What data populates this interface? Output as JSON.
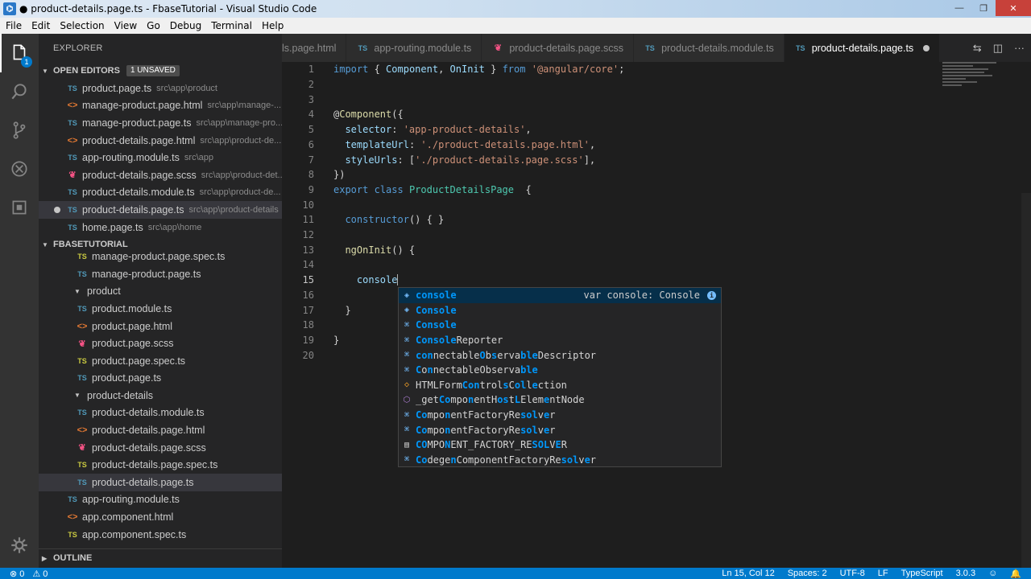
{
  "window": {
    "title": "● product-details.page.ts - FbaseTutorial - Visual Studio Code"
  },
  "menu": [
    "File",
    "Edit",
    "Selection",
    "View",
    "Go",
    "Debug",
    "Terminal",
    "Help"
  ],
  "activity": {
    "explorer_badge": "1"
  },
  "sidebar": {
    "title": "EXPLORER",
    "open_editors": {
      "label": "OPEN EDITORS",
      "badge": "1 UNSAVED",
      "items": [
        {
          "name": "product.page.ts",
          "path": "src\\app\\product",
          "type": "ts"
        },
        {
          "name": "manage-product.page.html",
          "path": "src\\app\\manage-...",
          "type": "html"
        },
        {
          "name": "manage-product.page.ts",
          "path": "src\\app\\manage-pro...",
          "type": "ts"
        },
        {
          "name": "product-details.page.html",
          "path": "src\\app\\product-de...",
          "type": "html"
        },
        {
          "name": "app-routing.module.ts",
          "path": "src\\app",
          "type": "ts"
        },
        {
          "name": "product-details.page.scss",
          "path": "src\\app\\product-det...",
          "type": "scss"
        },
        {
          "name": "product-details.module.ts",
          "path": "src\\app\\product-de...",
          "type": "ts"
        },
        {
          "name": "product-details.page.ts",
          "path": "src\\app\\product-details",
          "type": "ts"
        },
        {
          "name": "home.page.ts",
          "path": "src\\app\\home",
          "type": "ts"
        }
      ]
    },
    "project": {
      "label": "FBASETUTORIAL",
      "items": [
        {
          "name": "manage-product.page.spec.ts",
          "type": "ts-y",
          "depth": 1
        },
        {
          "name": "manage-product.page.ts",
          "type": "ts",
          "depth": 1
        },
        {
          "name": "product",
          "type": "folder",
          "depth": 0
        },
        {
          "name": "product.module.ts",
          "type": "ts",
          "depth": 1
        },
        {
          "name": "product.page.html",
          "type": "html",
          "depth": 1
        },
        {
          "name": "product.page.scss",
          "type": "scss",
          "depth": 1
        },
        {
          "name": "product.page.spec.ts",
          "type": "ts-y",
          "depth": 1
        },
        {
          "name": "product.page.ts",
          "type": "ts",
          "depth": 1
        },
        {
          "name": "product-details",
          "type": "folder",
          "depth": 0
        },
        {
          "name": "product-details.module.ts",
          "type": "ts",
          "depth": 1
        },
        {
          "name": "product-details.page.html",
          "type": "html",
          "depth": 1
        },
        {
          "name": "product-details.page.scss",
          "type": "scss",
          "depth": 1
        },
        {
          "name": "product-details.page.spec.ts",
          "type": "ts-y",
          "depth": 1
        },
        {
          "name": "product-details.page.ts",
          "type": "ts",
          "depth": 1
        },
        {
          "name": "app-routing.module.ts",
          "type": "ts",
          "depth": 0
        },
        {
          "name": "app.component.html",
          "type": "html",
          "depth": 0
        },
        {
          "name": "app.component.spec.ts",
          "type": "ts-y",
          "depth": 0
        }
      ]
    },
    "outline_label": "OUTLINE"
  },
  "tabs": [
    {
      "label": "ls.page.html",
      "type": "none"
    },
    {
      "label": "app-routing.module.ts",
      "type": "ts"
    },
    {
      "label": "product-details.page.scss",
      "type": "scss"
    },
    {
      "label": "product-details.module.ts",
      "type": "ts"
    },
    {
      "label": "product-details.page.ts",
      "type": "ts",
      "active": true
    }
  ],
  "editor": {
    "current_line": 15,
    "lines": [
      [
        [
          "k",
          "import"
        ],
        [
          "p",
          " { "
        ],
        [
          "v",
          "Component"
        ],
        [
          "p",
          ", "
        ],
        [
          "v",
          "OnInit"
        ],
        [
          "p",
          " } "
        ],
        [
          "k",
          "from"
        ],
        [
          "p",
          " "
        ],
        [
          "s",
          "'@angular/core'"
        ],
        [
          "p",
          ";"
        ]
      ],
      [],
      [],
      [
        [
          "p",
          "@"
        ],
        [
          "f",
          "Component"
        ],
        [
          "p",
          "({"
        ]
      ],
      [
        [
          "p",
          "  "
        ],
        [
          "v",
          "selector"
        ],
        [
          "p",
          ": "
        ],
        [
          "s",
          "'app-product-details'"
        ],
        [
          "p",
          ","
        ]
      ],
      [
        [
          "p",
          "  "
        ],
        [
          "v",
          "templateUrl"
        ],
        [
          "p",
          ": "
        ],
        [
          "s",
          "'./product-details.page.html'"
        ],
        [
          "p",
          ","
        ]
      ],
      [
        [
          "p",
          "  "
        ],
        [
          "v",
          "styleUrls"
        ],
        [
          "p",
          ": ["
        ],
        [
          "s",
          "'./product-details.page.scss'"
        ],
        [
          "p",
          "],"
        ]
      ],
      [
        [
          "p",
          "})"
        ]
      ],
      [
        [
          "k",
          "export"
        ],
        [
          "p",
          " "
        ],
        [
          "k",
          "class"
        ],
        [
          "p",
          " "
        ],
        [
          "c",
          "ProductDetailsPage"
        ],
        [
          "p",
          "  {"
        ]
      ],
      [],
      [
        [
          "p",
          "  "
        ],
        [
          "k",
          "constructor"
        ],
        [
          "p",
          "() { }"
        ]
      ],
      [],
      [
        [
          "p",
          "  "
        ],
        [
          "f",
          "ngOnInit"
        ],
        [
          "p",
          "() {"
        ]
      ],
      [],
      [
        [
          "p",
          "    "
        ],
        [
          "v",
          "console"
        ]
      ],
      [],
      [
        [
          "p",
          "  }"
        ]
      ],
      [],
      [
        [
          "p",
          "}"
        ]
      ],
      []
    ]
  },
  "suggestions": [
    {
      "kind": "var",
      "parts": [
        [
          "m",
          "console"
        ]
      ],
      "detail": "var console: Console",
      "focused": true
    },
    {
      "kind": "var",
      "parts": [
        [
          "m",
          "Console"
        ]
      ]
    },
    {
      "kind": "iface",
      "parts": [
        [
          "m",
          "Console"
        ]
      ]
    },
    {
      "kind": "iface",
      "parts": [
        [
          "m",
          "Console"
        ],
        [
          "t",
          "Reporter"
        ]
      ]
    },
    {
      "kind": "iface",
      "parts": [
        [
          "m",
          "con"
        ],
        [
          "t",
          "nectable"
        ],
        [
          "m",
          "O"
        ],
        [
          "t",
          "b"
        ],
        [
          "m",
          "s"
        ],
        [
          "t",
          "erva"
        ],
        [
          "m",
          "ble"
        ],
        [
          "t",
          "Descriptor"
        ]
      ]
    },
    {
      "kind": "iface",
      "parts": [
        [
          "m",
          "C"
        ],
        [
          "t",
          "o"
        ],
        [
          "m",
          "n"
        ],
        [
          "t",
          "nectableObserva"
        ],
        [
          "m",
          "ble"
        ]
      ]
    },
    {
      "kind": "class",
      "parts": [
        [
          "t",
          "HTMLForm"
        ],
        [
          "m",
          "Con"
        ],
        [
          "t",
          "trol"
        ],
        [
          "m",
          "s"
        ],
        [
          "t",
          "C"
        ],
        [
          "m",
          "ol"
        ],
        [
          "t",
          "l"
        ],
        [
          "m",
          "e"
        ],
        [
          "t",
          "ction"
        ]
      ]
    },
    {
      "kind": "fn",
      "parts": [
        [
          "t",
          "_get"
        ],
        [
          "m",
          "Co"
        ],
        [
          "t",
          "mpo"
        ],
        [
          "m",
          "n"
        ],
        [
          "t",
          "entH"
        ],
        [
          "m",
          "os"
        ],
        [
          "t",
          "t"
        ],
        [
          "m",
          "L"
        ],
        [
          "t",
          "Elem"
        ],
        [
          "m",
          "e"
        ],
        [
          "t",
          "ntNode"
        ]
      ]
    },
    {
      "kind": "iface",
      "parts": [
        [
          "m",
          "Co"
        ],
        [
          "t",
          "mpo"
        ],
        [
          "m",
          "n"
        ],
        [
          "t",
          "entFactoryRe"
        ],
        [
          "m",
          "sol"
        ],
        [
          "t",
          "v"
        ],
        [
          "m",
          "e"
        ],
        [
          "t",
          "r"
        ]
      ]
    },
    {
      "kind": "iface",
      "parts": [
        [
          "m",
          "Co"
        ],
        [
          "t",
          "mpo"
        ],
        [
          "m",
          "n"
        ],
        [
          "t",
          "entFactoryRe"
        ],
        [
          "m",
          "sol"
        ],
        [
          "t",
          "v"
        ],
        [
          "m",
          "e"
        ],
        [
          "t",
          "r"
        ]
      ]
    },
    {
      "kind": "const",
      "parts": [
        [
          "m",
          "CO"
        ],
        [
          "t",
          "MPO"
        ],
        [
          "m",
          "N"
        ],
        [
          "t",
          "ENT_FACTORY_RE"
        ],
        [
          "m",
          "SOL"
        ],
        [
          "t",
          "V"
        ],
        [
          "m",
          "E"
        ],
        [
          "t",
          "R"
        ]
      ]
    },
    {
      "kind": "iface",
      "parts": [
        [
          "m",
          "Co"
        ],
        [
          "t",
          "dege"
        ],
        [
          "m",
          "n"
        ],
        [
          "t",
          "ComponentFactoryRe"
        ],
        [
          "m",
          "sol"
        ],
        [
          "t",
          "v"
        ],
        [
          "m",
          "e"
        ],
        [
          "t",
          "r"
        ]
      ]
    }
  ],
  "statusbar": {
    "errors": "⊗ 0",
    "warnings": "⚠ 0",
    "position": "Ln 15, Col 12",
    "spaces": "Spaces: 2",
    "encoding": "UTF-8",
    "eol": "LF",
    "language": "TypeScript",
    "version": "3.0.3"
  },
  "colors": {
    "accent": "#007acc",
    "keyword": "#569cd6",
    "string": "#ce9178",
    "class": "#4ec9b0",
    "variable": "#9cdcfe",
    "function": "#dcdcaa",
    "match": "#0097fb"
  }
}
